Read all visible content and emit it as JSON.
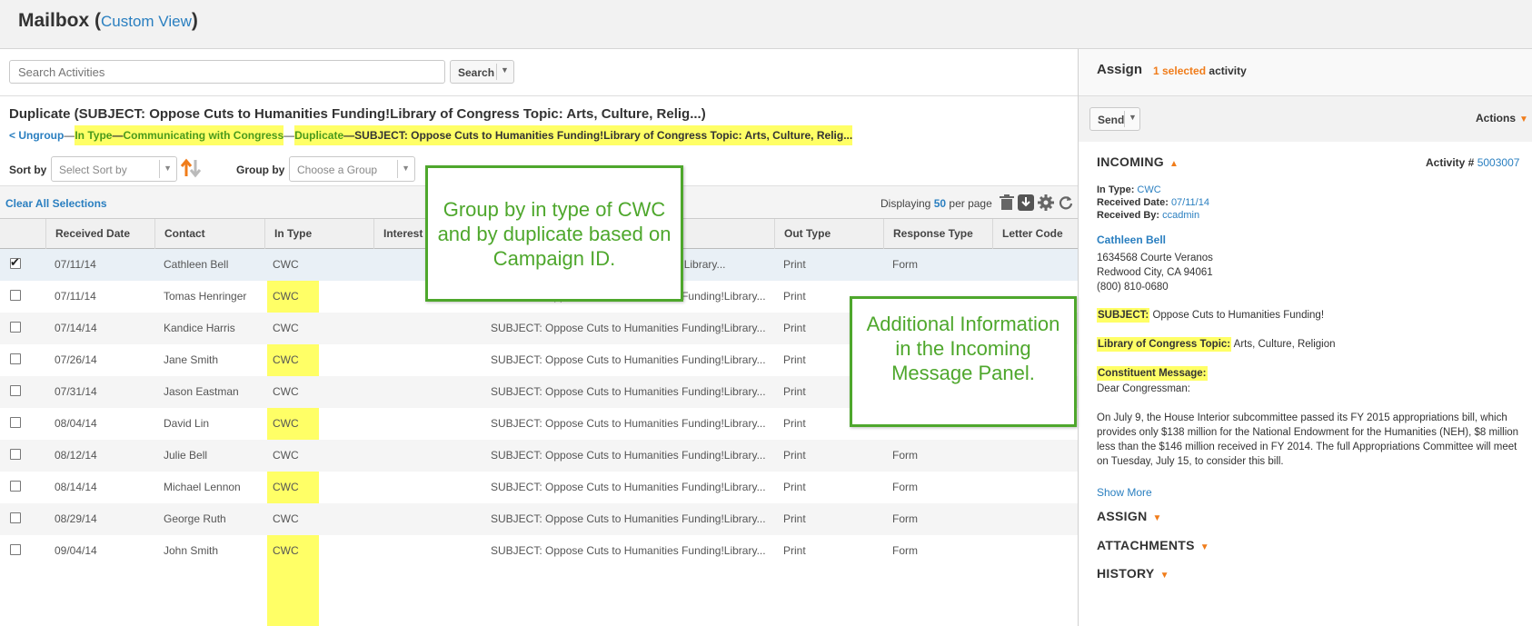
{
  "header": {
    "title": "Mailbox (",
    "custom_view": "Custom View",
    "close_paren": ")"
  },
  "search": {
    "placeholder": "Search Activities",
    "button_label": "Search"
  },
  "duplicate_title": "Duplicate (SUBJECT: Oppose Cuts to Humanities Funding!Library of Congress Topic: Arts, Culture, Relig...)",
  "breadcrumbs": {
    "ungroup": "< Ungroup",
    "sep1": " —",
    "in_type": "In Type",
    "sep2": " — ",
    "communicating": "Communicating with Congress",
    "sep3": " — ",
    "duplicate": "Duplicate",
    "sep4": " —  ",
    "subject": "SUBJECT: Oppose Cuts to Humanities Funding!Library of Congress Topic: Arts, Culture, Relig..."
  },
  "sort": {
    "label": "Sort by",
    "placeholder": "Select Sort by"
  },
  "group": {
    "label": "Group by",
    "placeholder": "Choose a Group"
  },
  "toolbar": {
    "clear_all": "Clear All Selections",
    "displaying": "Displaying",
    "per_page_count": "50",
    "per_page": "per page"
  },
  "columns": [
    "Received Date",
    "Contact",
    "In Type",
    "Interest",
    "Out Type",
    "Response Type",
    "Letter Code"
  ],
  "rows": [
    {
      "date": "07/11/14",
      "contact": "Cathleen Bell",
      "in_type": "CWC",
      "subject": "nding!Library...",
      "out_type": "Print",
      "response": "Form",
      "checked": true
    },
    {
      "date": "07/11/14",
      "contact": "Tomas Henringer",
      "in_type": "CWC",
      "subject": "SUBJECT: Oppose Cuts to Humanities Funding!Library...",
      "out_type": "Print",
      "response": "",
      "checked": false
    },
    {
      "date": "07/14/14",
      "contact": "Kandice Harris",
      "in_type": "CWC",
      "subject": "SUBJECT: Oppose Cuts to Humanities Funding!Library...",
      "out_type": "Print",
      "response": "",
      "checked": false
    },
    {
      "date": "07/26/14",
      "contact": "Jane Smith",
      "in_type": "CWC",
      "subject": "SUBJECT: Oppose Cuts to Humanities Funding!Library...",
      "out_type": "Print",
      "response": "",
      "checked": false
    },
    {
      "date": "07/31/14",
      "contact": "Jason Eastman",
      "in_type": "CWC",
      "subject": "SUBJECT: Oppose Cuts to Humanities Funding!Library...",
      "out_type": "Print",
      "response": "",
      "checked": false
    },
    {
      "date": "08/04/14",
      "contact": "David Lin",
      "in_type": "CWC",
      "subject": "SUBJECT: Oppose Cuts to Humanities Funding!Library...",
      "out_type": "Print",
      "response": "Form",
      "checked": false
    },
    {
      "date": "08/12/14",
      "contact": "Julie Bell",
      "in_type": "CWC",
      "subject": "SUBJECT: Oppose Cuts to Humanities Funding!Library...",
      "out_type": "Print",
      "response": "Form",
      "checked": false
    },
    {
      "date": "08/14/14",
      "contact": "Michael Lennon",
      "in_type": "CWC",
      "subject": "SUBJECT: Oppose Cuts to Humanities Funding!Library...",
      "out_type": "Print",
      "response": "Form",
      "checked": false
    },
    {
      "date": "08/29/14",
      "contact": "George Ruth",
      "in_type": "CWC",
      "subject": "SUBJECT: Oppose Cuts to Humanities Funding!Library...",
      "out_type": "Print",
      "response": "Form",
      "checked": false
    },
    {
      "date": "09/04/14",
      "contact": "John Smith",
      "in_type": "CWC",
      "subject": "SUBJECT: Oppose Cuts to Humanities Funding!Library...",
      "out_type": "Print",
      "response": "Form",
      "checked": false
    }
  ],
  "callouts": {
    "group_by": "Group by in type of CWC and by duplicate based on Campaign ID.",
    "additional": "Additional Information in the Incoming Message Panel."
  },
  "assign_panel": {
    "title": "Assign",
    "selected": "1 selected",
    "activity_word": "activity",
    "send_label": "Send",
    "actions_label": "Actions",
    "incoming": "INCOMING",
    "activity_label": "Activity #",
    "activity_number": "5003007",
    "in_type_label": "In Type:",
    "in_type_value": "CWC",
    "received_date_label": "Received Date:",
    "received_date_value": "07/11/14",
    "received_by_label": "Received By:",
    "received_by_value": "ccadmin",
    "contact_name": "Cathleen Bell",
    "address_line1": "1634568 Courte Veranos",
    "address_line2": "Redwood City, CA 94061",
    "phone": "(800) 810-0680",
    "subject_label": "SUBJECT:",
    "subject_value": "Oppose Cuts to Humanities Funding!",
    "loc_label": "Library of Congress Topic:",
    "loc_value": "Arts, Culture, Religion",
    "constituent_label": "Constituent Message:",
    "greeting": "Dear Congressman:",
    "body": "On July 9, the House Interior subcommittee passed its FY 2015 appropriations bill, which provides only $138 million for the National Endowment for the Humanities (NEH), $8 million less than the $146 million received in FY 2014. The full Appropriations Committee will meet on Tuesday, July 15, to consider this bill.",
    "show_more": "Show More",
    "assign_section": "ASSIGN",
    "attachments_section": "ATTACHMENTS",
    "history_section": "HISTORY"
  },
  "colors": {
    "link": "#2a7fc0",
    "accent": "#f07c1a",
    "highlight": "#ffff66",
    "callout": "#4ea72c"
  }
}
